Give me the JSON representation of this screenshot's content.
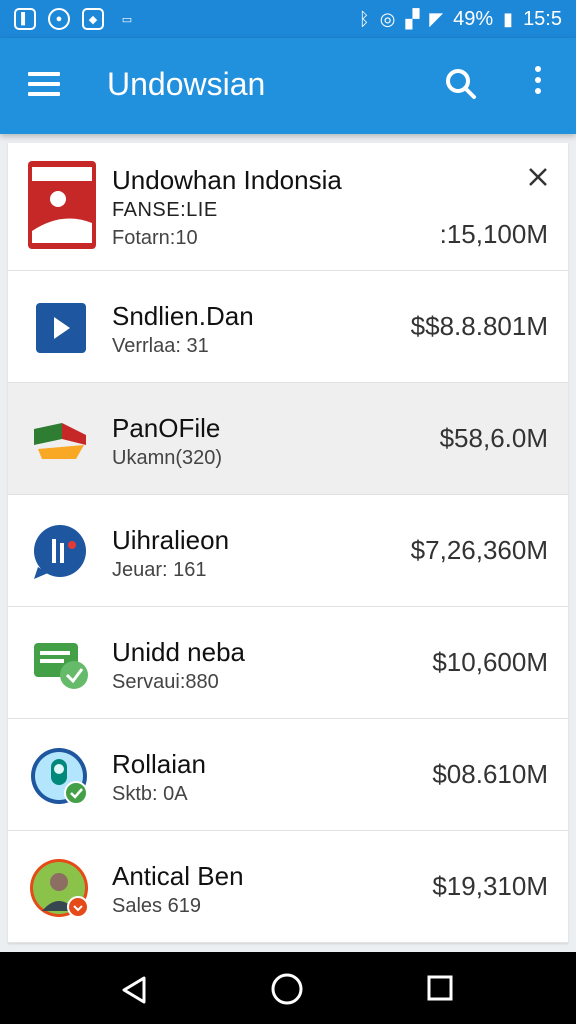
{
  "status_bar": {
    "battery": "49%",
    "time": "15:5"
  },
  "app_bar": {
    "title": "Undowsian"
  },
  "items": [
    {
      "name": "Undowhan Indonsia",
      "tagline": "FANSE:LIE",
      "subtitle": "Fotarn:10",
      "amount": ":15,100M",
      "logo_color": "#c62828"
    },
    {
      "name": "Sndlien.Dan",
      "subtitle": "Verrlaa: 31",
      "amount": "$$8.8.801M",
      "logo_color": "#1e56a0"
    },
    {
      "name": "PanOFile",
      "subtitle": "Ukamn(320)",
      "amount": "$58,6.0M",
      "logo_color": "#2e7d32"
    },
    {
      "name": "Uihralieon",
      "subtitle": "Jeuar: 161",
      "amount": "$7,26,360M",
      "logo_color": "#1e56a0"
    },
    {
      "name": "Unidd neba",
      "subtitle": "Servaui:880",
      "amount": "$10,600M",
      "logo_color": "#43a047"
    },
    {
      "name": "Rollaian",
      "subtitle": "Sktb: 0A",
      "amount": "$08.610M",
      "logo_color": "#1e56a0"
    },
    {
      "name": "Antical Ben",
      "subtitle": "Sales 619",
      "amount": "$19,310M",
      "logo_color": "#e64a19"
    }
  ],
  "colors": {
    "app_bar": "#2190dd",
    "status_bar": "#1e88d8",
    "selected_row": "#efefef"
  }
}
